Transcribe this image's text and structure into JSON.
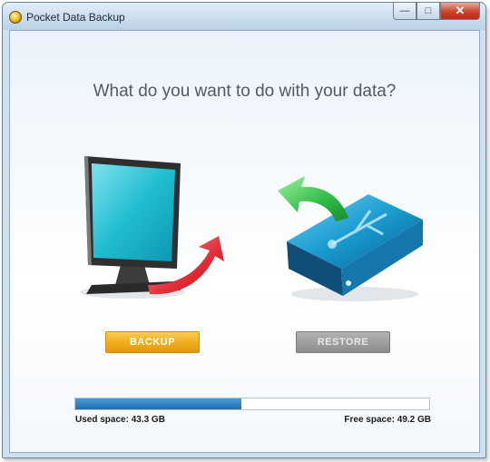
{
  "window": {
    "title": "Pocket Data Backup",
    "controls": {
      "minimize": "—",
      "maximize": "□",
      "close": "✕"
    }
  },
  "main": {
    "headline": "What do you want to do with your data?",
    "backup_label": "BACKUP",
    "restore_label": "RESTORE"
  },
  "storage": {
    "used_label": "Used space: 43.3 GB",
    "free_label": "Free space: 49.2 GB",
    "used_fraction": 0.468
  },
  "colors": {
    "backup_button": "#efab1b",
    "restore_button": "#8d8d8d",
    "storage_fill": "#1d6eb5"
  },
  "icons": [
    "app-icon",
    "computer-monitor-icon",
    "backup-arrow-icon",
    "external-drive-icon",
    "restore-arrow-icon"
  ]
}
